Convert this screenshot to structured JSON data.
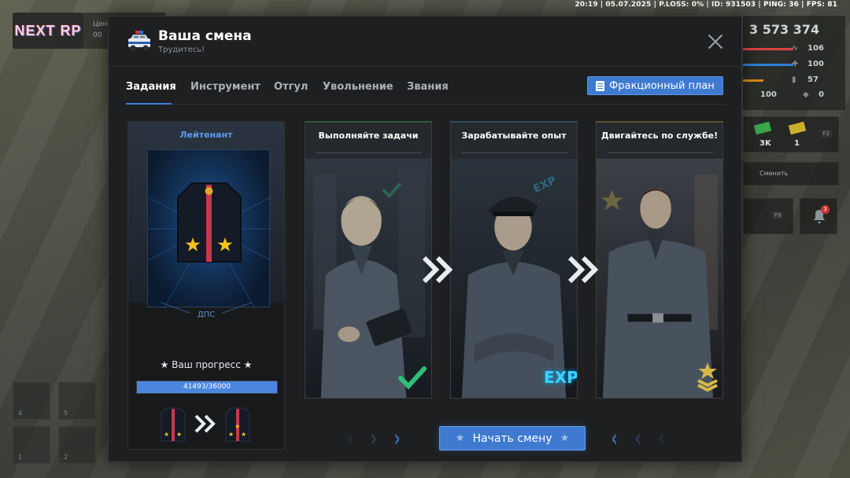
{
  "hud": {
    "status_line": "20:19 | 05.07.2025 | P.LOSS: 0% | ID: 931503 | PING: 36 | FPS: 81",
    "money": "3 573 374",
    "stats": [
      {
        "icon": "heartbeat-icon",
        "value": "106"
      },
      {
        "icon": "armor-icon",
        "value": "100"
      },
      {
        "icon": "ammo-icon",
        "value": "57"
      },
      {
        "icon": "hunger-icon",
        "value": "100"
      },
      {
        "icon": "shield-icon",
        "value": "0"
      }
    ],
    "side_panel": {
      "cash_1": "3K",
      "cash_2": "1",
      "key_f2": "F2",
      "switch_label": "Сменить",
      "key_f9": "F9",
      "notification_count": "3"
    },
    "slots": [
      "4",
      "5",
      "1",
      "2"
    ],
    "logo_text": "NEXT RP",
    "partial_left_text_1": "Цен",
    "partial_left_text_2": "00"
  },
  "modal": {
    "title": "Ваша смена",
    "subtitle": "Трудитесь!",
    "tabs": [
      {
        "label": "Задания",
        "active": true
      },
      {
        "label": "Инструмент",
        "active": false
      },
      {
        "label": "Отгул",
        "active": false
      },
      {
        "label": "Увольнение",
        "active": false
      },
      {
        "label": "Звания",
        "active": false
      }
    ],
    "plan_button": "Фракционный план",
    "rank_card": {
      "rank_name": "Лейтенант",
      "department": "ДПС",
      "progress_label": "★ Ваш прогресс ★",
      "progress_current": 41493,
      "progress_max": 36000,
      "progress_text": "41493/36000"
    },
    "stages": [
      {
        "title": "Выполняйте задачи",
        "badge": "checkmark-icon",
        "accent": "#2fbf7b"
      },
      {
        "title": "Зарабатывайте опыт",
        "badge": "EXP",
        "accent": "#3ad3ff"
      },
      {
        "title": "Двигайтесь по службе!",
        "badge": "rank-up-icon",
        "accent": "#d9b84a"
      }
    ],
    "start_button": "Начать смену"
  },
  "colors": {
    "accent_blue": "#3e7ad0",
    "rank_blue": "#5d9cf0",
    "panel_bg": "#1e1f21"
  }
}
